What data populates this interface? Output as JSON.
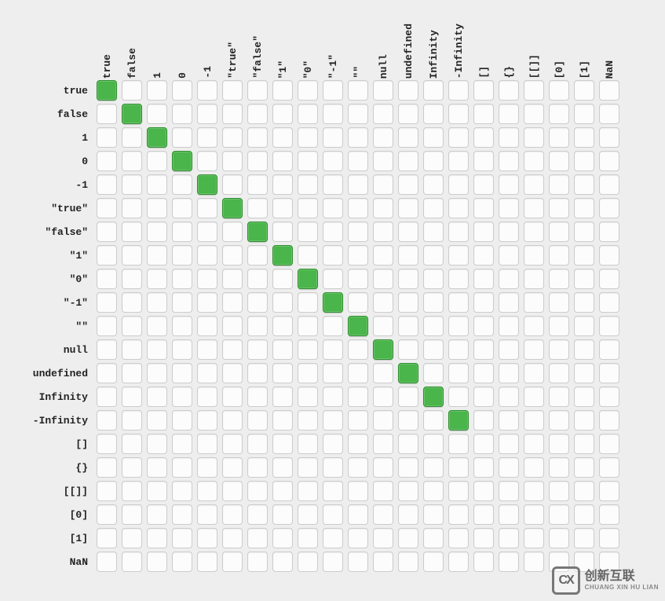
{
  "chart_data": {
    "type": "heatmap",
    "title": "",
    "xlabel": "",
    "ylabel": "",
    "x": [
      "true",
      "false",
      "1",
      "0",
      "-1",
      "\"true\"",
      "\"false\"",
      "\"1\"",
      "\"0\"",
      "\"-1\"",
      "\"\"",
      "null",
      "undefined",
      "Infinity",
      "-Infinity",
      "[]",
      "{}",
      "[[]]",
      "[0]",
      "[1]",
      "NaN"
    ],
    "y": [
      "true",
      "false",
      "1",
      "0",
      "-1",
      "\"true\"",
      "\"false\"",
      "\"1\"",
      "\"0\"",
      "\"-1\"",
      "\"\"",
      "null",
      "undefined",
      "Infinity",
      "-Infinity",
      "[]",
      "{}",
      "[[]]",
      "[0]",
      "[1]",
      "NaN"
    ],
    "matrix": [
      [
        1,
        0,
        0,
        0,
        0,
        0,
        0,
        0,
        0,
        0,
        0,
        0,
        0,
        0,
        0,
        0,
        0,
        0,
        0,
        0,
        0
      ],
      [
        0,
        1,
        0,
        0,
        0,
        0,
        0,
        0,
        0,
        0,
        0,
        0,
        0,
        0,
        0,
        0,
        0,
        0,
        0,
        0,
        0
      ],
      [
        0,
        0,
        1,
        0,
        0,
        0,
        0,
        0,
        0,
        0,
        0,
        0,
        0,
        0,
        0,
        0,
        0,
        0,
        0,
        0,
        0
      ],
      [
        0,
        0,
        0,
        1,
        0,
        0,
        0,
        0,
        0,
        0,
        0,
        0,
        0,
        0,
        0,
        0,
        0,
        0,
        0,
        0,
        0
      ],
      [
        0,
        0,
        0,
        0,
        1,
        0,
        0,
        0,
        0,
        0,
        0,
        0,
        0,
        0,
        0,
        0,
        0,
        0,
        0,
        0,
        0
      ],
      [
        0,
        0,
        0,
        0,
        0,
        1,
        0,
        0,
        0,
        0,
        0,
        0,
        0,
        0,
        0,
        0,
        0,
        0,
        0,
        0,
        0
      ],
      [
        0,
        0,
        0,
        0,
        0,
        0,
        1,
        0,
        0,
        0,
        0,
        0,
        0,
        0,
        0,
        0,
        0,
        0,
        0,
        0,
        0
      ],
      [
        0,
        0,
        0,
        0,
        0,
        0,
        0,
        1,
        0,
        0,
        0,
        0,
        0,
        0,
        0,
        0,
        0,
        0,
        0,
        0,
        0
      ],
      [
        0,
        0,
        0,
        0,
        0,
        0,
        0,
        0,
        1,
        0,
        0,
        0,
        0,
        0,
        0,
        0,
        0,
        0,
        0,
        0,
        0
      ],
      [
        0,
        0,
        0,
        0,
        0,
        0,
        0,
        0,
        0,
        1,
        0,
        0,
        0,
        0,
        0,
        0,
        0,
        0,
        0,
        0,
        0
      ],
      [
        0,
        0,
        0,
        0,
        0,
        0,
        0,
        0,
        0,
        0,
        1,
        0,
        0,
        0,
        0,
        0,
        0,
        0,
        0,
        0,
        0
      ],
      [
        0,
        0,
        0,
        0,
        0,
        0,
        0,
        0,
        0,
        0,
        0,
        1,
        0,
        0,
        0,
        0,
        0,
        0,
        0,
        0,
        0
      ],
      [
        0,
        0,
        0,
        0,
        0,
        0,
        0,
        0,
        0,
        0,
        0,
        0,
        1,
        0,
        0,
        0,
        0,
        0,
        0,
        0,
        0
      ],
      [
        0,
        0,
        0,
        0,
        0,
        0,
        0,
        0,
        0,
        0,
        0,
        0,
        0,
        1,
        0,
        0,
        0,
        0,
        0,
        0,
        0
      ],
      [
        0,
        0,
        0,
        0,
        0,
        0,
        0,
        0,
        0,
        0,
        0,
        0,
        0,
        0,
        1,
        0,
        0,
        0,
        0,
        0,
        0
      ],
      [
        0,
        0,
        0,
        0,
        0,
        0,
        0,
        0,
        0,
        0,
        0,
        0,
        0,
        0,
        0,
        0,
        0,
        0,
        0,
        0,
        0
      ],
      [
        0,
        0,
        0,
        0,
        0,
        0,
        0,
        0,
        0,
        0,
        0,
        0,
        0,
        0,
        0,
        0,
        0,
        0,
        0,
        0,
        0
      ],
      [
        0,
        0,
        0,
        0,
        0,
        0,
        0,
        0,
        0,
        0,
        0,
        0,
        0,
        0,
        0,
        0,
        0,
        0,
        0,
        0,
        0
      ],
      [
        0,
        0,
        0,
        0,
        0,
        0,
        0,
        0,
        0,
        0,
        0,
        0,
        0,
        0,
        0,
        0,
        0,
        0,
        0,
        0,
        0
      ],
      [
        0,
        0,
        0,
        0,
        0,
        0,
        0,
        0,
        0,
        0,
        0,
        0,
        0,
        0,
        0,
        0,
        0,
        0,
        0,
        0,
        0
      ],
      [
        0,
        0,
        0,
        0,
        0,
        0,
        0,
        0,
        0,
        0,
        0,
        0,
        0,
        0,
        0,
        0,
        0,
        0,
        0,
        0,
        0
      ]
    ],
    "legend": {
      "on_color": "#4ab54a",
      "off_color": "#fcfcfc"
    }
  },
  "watermark": {
    "logo_text": "CX",
    "main": "创新互联",
    "sub": "CHUANG XIN HU LIAN"
  }
}
